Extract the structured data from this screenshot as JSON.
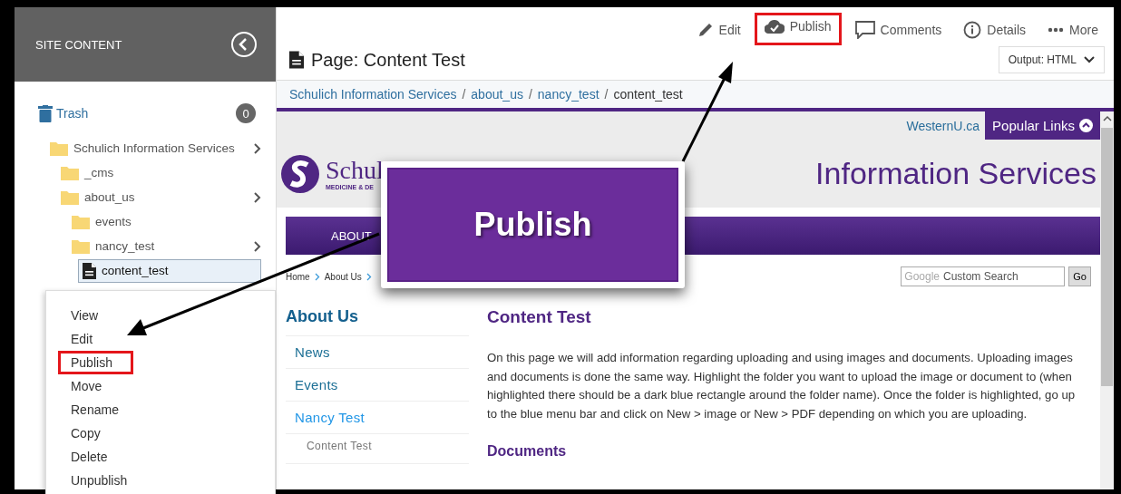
{
  "sidebar": {
    "title": "SITE CONTENT",
    "trash": {
      "label": "Trash",
      "count": "0"
    },
    "tree": [
      {
        "label": "Schulich Information Services",
        "kind": "folder",
        "expandable": true,
        "selected": false,
        "children": [
          {
            "label": "_cms",
            "kind": "folder",
            "expandable": false,
            "selected": false
          },
          {
            "label": "about_us",
            "kind": "folder",
            "expandable": true,
            "selected": false,
            "children": [
              {
                "label": "events",
                "kind": "folder",
                "expandable": false,
                "selected": false
              },
              {
                "label": "nancy_test",
                "kind": "folder",
                "expandable": true,
                "selected": false,
                "children": [
                  {
                    "label": "content_test",
                    "kind": "page",
                    "expandable": false,
                    "selected": true
                  }
                ]
              }
            ]
          }
        ]
      }
    ]
  },
  "context_menu": {
    "items": [
      {
        "label": "View",
        "highlighted": false
      },
      {
        "label": "Edit",
        "highlighted": false
      },
      {
        "label": "Publish",
        "highlighted": true
      },
      {
        "label": "Move",
        "highlighted": false
      },
      {
        "label": "Rename",
        "highlighted": false
      },
      {
        "label": "Copy",
        "highlighted": false
      },
      {
        "label": "Delete",
        "highlighted": false
      },
      {
        "label": "Unpublish",
        "highlighted": false
      }
    ]
  },
  "toolbar": {
    "actions": [
      {
        "kind": "edit",
        "label": "Edit",
        "highlighted": false
      },
      {
        "kind": "publish",
        "label": "Publish",
        "highlighted": true
      },
      {
        "kind": "comments",
        "label": "Comments",
        "highlighted": false
      },
      {
        "kind": "details",
        "label": "Details",
        "highlighted": false
      },
      {
        "kind": "more",
        "label": "More",
        "highlighted": false
      }
    ]
  },
  "page": {
    "title": "Page: Content Test",
    "output": "Output: HTML"
  },
  "breadcrumb": {
    "separator": "/",
    "items": [
      "Schulich Information Services",
      "about_us",
      "nancy_test",
      "content_test"
    ]
  },
  "preview": {
    "top_link": "WesternU.ca",
    "popular_links": "Popular Links",
    "logo_text": "Schul",
    "logo_subtext": "MEDICINE & DE",
    "site_title": "Information Services",
    "nav": [
      "ABOUT"
    ],
    "crumbs": [
      "Home",
      "About Us"
    ],
    "search": {
      "brand": "Google",
      "placeholder": "Custom Search",
      "button": "Go"
    },
    "left_nav": {
      "title": "About Us",
      "items": [
        {
          "label": "News",
          "selected": false
        },
        {
          "label": "Events",
          "selected": false
        },
        {
          "label": "Nancy Test",
          "selected": true,
          "children": [
            {
              "label": "Content Test"
            }
          ]
        }
      ]
    },
    "heading": "Content Test",
    "body": "On this page we will add information regarding uploading and using images and documents. Uploading images and documents is done the same way. Highlight the folder you want to upload the image or document to (when highlighted there should be a dark blue rectangle around the folder name). Once the folder is highlighted, go up to the blue menu bar and click on New > image or New > PDF depending on which you are uploading.",
    "subheading": "Documents"
  },
  "callout": {
    "label": "Publish"
  }
}
